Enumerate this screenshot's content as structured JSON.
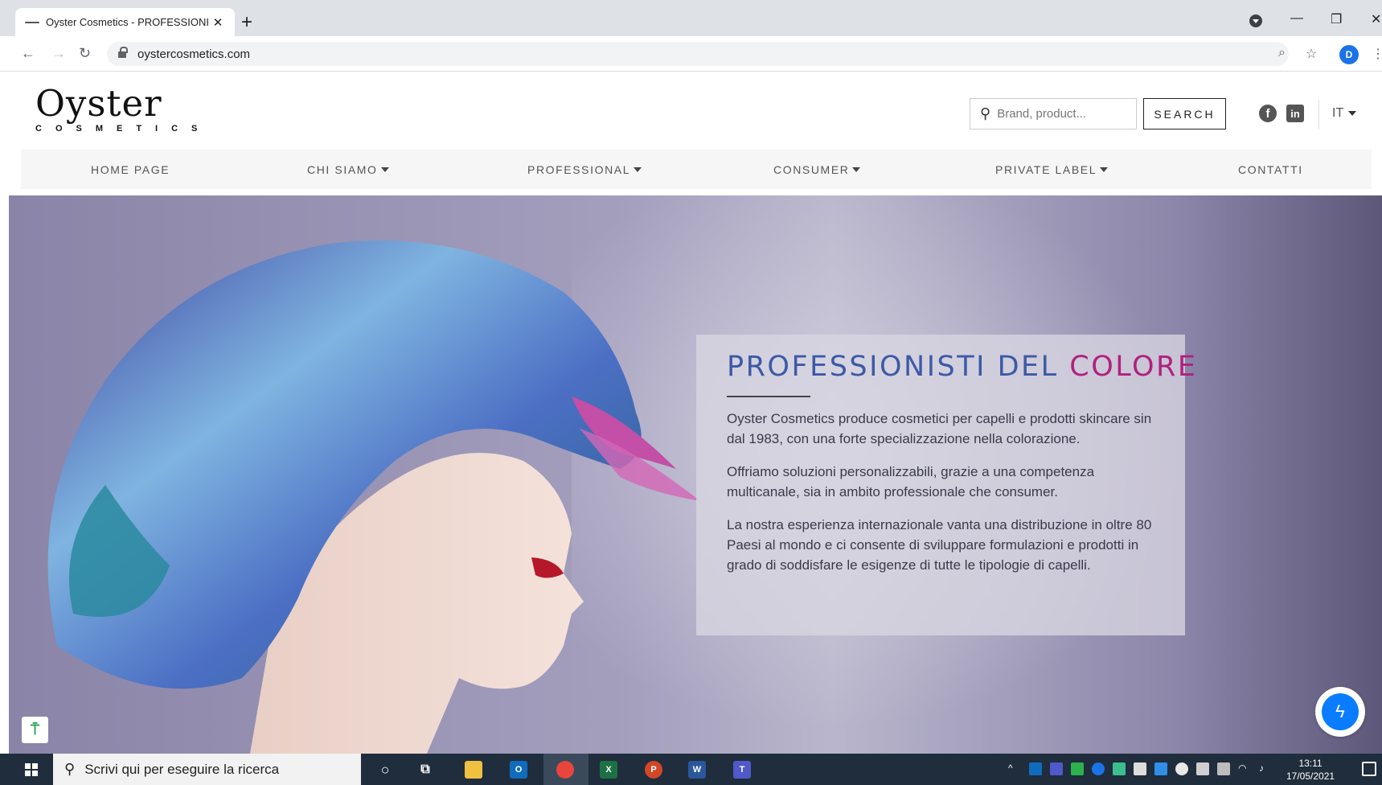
{
  "browser": {
    "tab_title": "Oyster Cosmetics - PROFESSIONI",
    "tab_close": "✕",
    "new_tab": "+",
    "url": "oystercosmetics.com",
    "profile_initial": "D"
  },
  "header": {
    "logo_main": "Oyster",
    "logo_sub": "COSMETICS",
    "search_placeholder": "Brand, product...",
    "search_button": "SEARCH",
    "social": [
      "facebook-icon",
      "linkedin-icon"
    ],
    "language": "IT"
  },
  "nav": {
    "items": [
      {
        "label": "HOME PAGE",
        "dropdown": false
      },
      {
        "label": "CHI SIAMO",
        "dropdown": true
      },
      {
        "label": "PROFESSIONAL",
        "dropdown": true
      },
      {
        "label": "CONSUMER",
        "dropdown": true
      },
      {
        "label": "PRIVATE LABEL",
        "dropdown": true
      },
      {
        "label": "CONTATTI",
        "dropdown": false
      }
    ]
  },
  "hero": {
    "title_part1": "PROFESSIONISTI DEL ",
    "title_accent": "COLORE",
    "paragraphs": [
      "Oyster Cosmetics produce cosmetici per capelli e prodotti skincare sin dal 1983, con una forte specializzazione nella colorazione.",
      "Offriamo soluzioni personalizzabili, grazie a una competenza multicanale, sia in ambito professionale che consumer.",
      "La nostra esperienza internazionale vanta una distribuzione in oltre 80 Paesi al mondo e ci consente di sviluppare formulazioni e prodotti in grado di soddisfare le esigenze di tutte le tipologie di capelli."
    ]
  },
  "taskbar": {
    "search_placeholder": "Scrivi qui per eseguire la ricerca",
    "time": "13:11",
    "date": "17/05/2021"
  },
  "colors": {
    "title_blue": "#3c5aa6",
    "title_magenta": "#b1217d",
    "messenger_blue": "#0a7cff"
  }
}
